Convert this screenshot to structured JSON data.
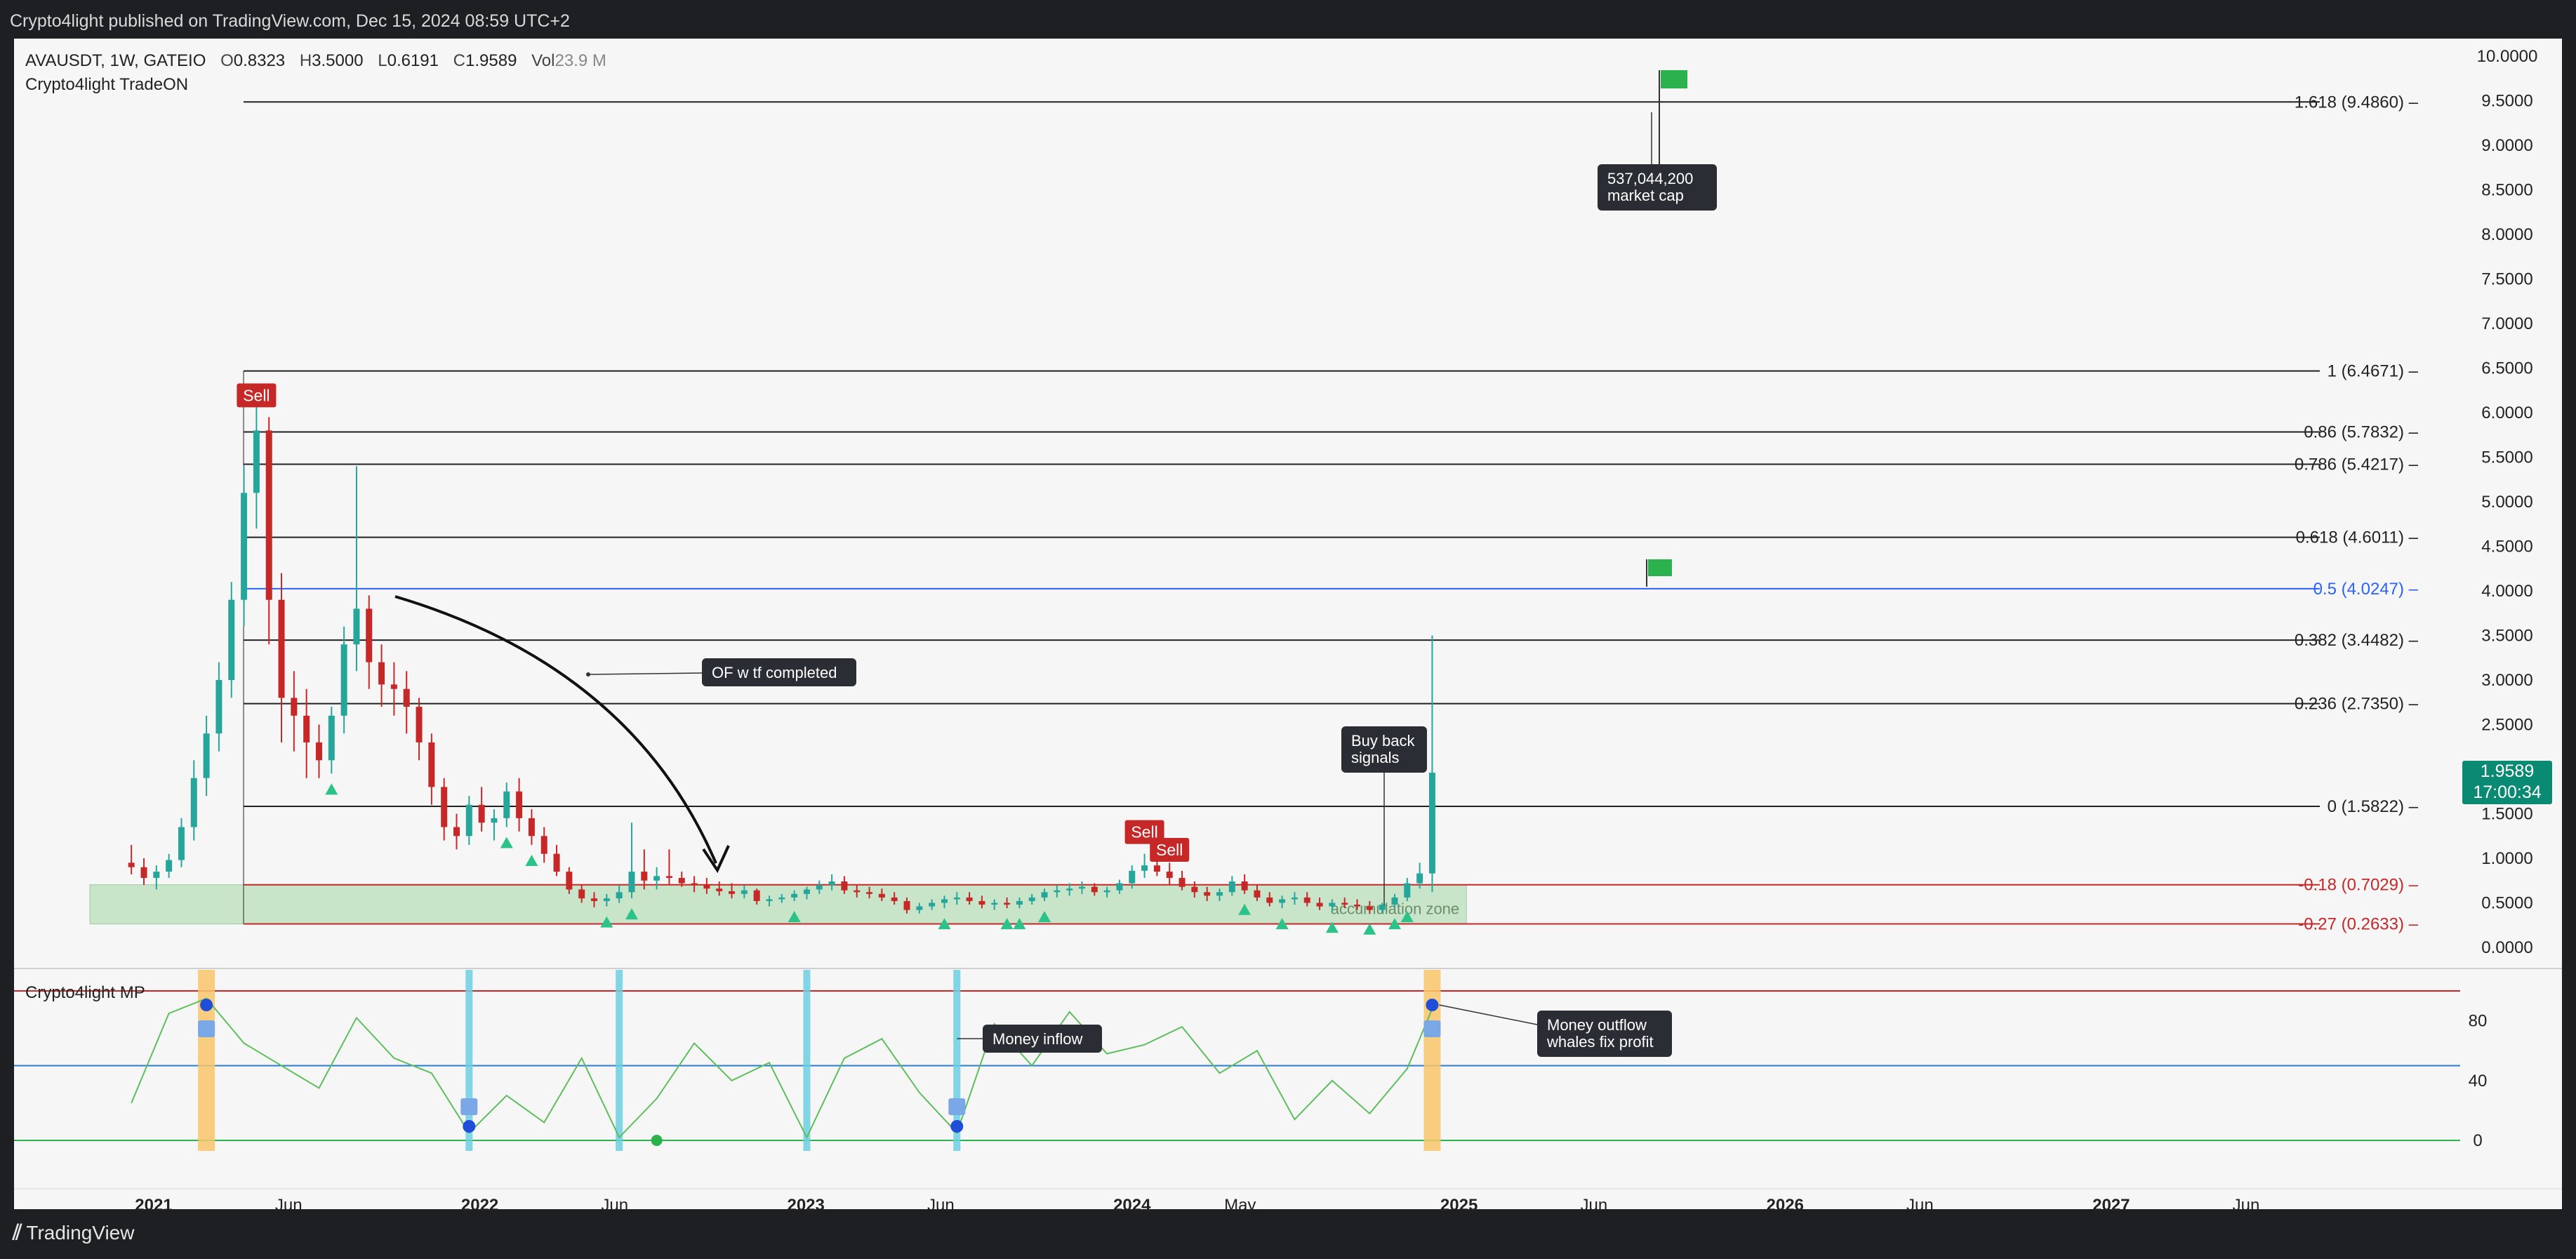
{
  "header": {
    "published": "Crypto4light published on TradingView.com, Dec 15, 2024 08:59 UTC+2"
  },
  "legend": {
    "symbol": "AVAUSDT, 1W, GATEIO",
    "open_label": "O",
    "open": "0.8323",
    "high_label": "H",
    "high": "3.5000",
    "low_label": "L",
    "low": "0.6191",
    "close_label": "C",
    "close": "1.9589",
    "vol_label": "Vol",
    "vol": "23.9 M",
    "indicator": "Crypto4light TradeON"
  },
  "current_price": {
    "value": "1.9589",
    "countdown": "17:00:34"
  },
  "oscillator": {
    "title": "Crypto4light MP"
  },
  "brand": {
    "name": "TradingView"
  },
  "colors": {
    "up": "#26a69a",
    "down": "#c62828",
    "fib": "#222222",
    "fib_mid": "#2962ff",
    "fib_neg": "#c62828",
    "zone": "#b9dfba",
    "signal": "#2cc38b",
    "osc_line": "#5cbf5c",
    "inflow": "#6ccfe0",
    "outflow": "#f9c56b"
  },
  "chart_data": [
    {
      "type": "candlestick",
      "title": "AVAUSDT, 1W, GATEIO",
      "ylim": [
        0,
        10
      ],
      "y_ticks": [
        "0.0000",
        "0.5000",
        "1.0000",
        "1.5000",
        "2.0000",
        "2.5000",
        "3.0000",
        "3.5000",
        "4.0000",
        "4.5000",
        "5.0000",
        "5.5000",
        "6.0000",
        "6.5000",
        "7.0000",
        "7.5000",
        "8.0000",
        "8.5000",
        "9.0000",
        "9.5000",
        "10.0000"
      ],
      "x_ticks": [
        "2021",
        "Jun",
        "2022",
        "Jun",
        "2023",
        "Jun",
        "2024",
        "May",
        "2025",
        "Jun",
        "2026",
        "Jun",
        "2027",
        "Jun"
      ],
      "x_tick_dates": [
        "2021-01-01",
        "2021-06-01",
        "2022-01-01",
        "2022-06-01",
        "2023-01-01",
        "2023-06-01",
        "2024-01-01",
        "2024-05-01",
        "2025-01-01",
        "2025-06-01",
        "2026-01-01",
        "2026-06-01",
        "2027-01-01",
        "2027-06-01"
      ],
      "fib_levels": [
        {
          "label": "1.618 (9.4860)",
          "value": 9.486
        },
        {
          "label": "1 (6.4671)",
          "value": 6.4671
        },
        {
          "label": "0.86 (5.7832)",
          "value": 5.7832
        },
        {
          "label": "0.786 (5.4217)",
          "value": 5.4217
        },
        {
          "label": "0.618 (4.6011)",
          "value": 4.6011
        },
        {
          "label": "0.5 (4.0247)",
          "value": 4.0247
        },
        {
          "label": "0.382 (3.4482)",
          "value": 3.4482
        },
        {
          "label": "0.236 (2.7350)",
          "value": 2.735
        },
        {
          "label": "0 (1.5822)",
          "value": 1.5822
        },
        {
          "label": "-0.18 (0.7029)",
          "value": 0.7029
        },
        {
          "label": "-0.27 (0.2633)",
          "value": 0.2633
        }
      ],
      "zone": {
        "label": "accumulation zone",
        "low": 0.2633,
        "high": 0.7029,
        "from": "2020-12-01",
        "to": "2024-12-01"
      },
      "annotations": [
        {
          "text": "OF w tf completed"
        },
        {
          "text": "Buy back signals"
        },
        {
          "text": "537,044,200 market cap"
        }
      ],
      "sell_labels": [
        "Sell",
        "Sell",
        "Sell"
      ],
      "candles": [
        [
          "2020-12-07",
          0.95,
          1.15,
          0.82,
          0.9
        ],
        [
          "2020-12-21",
          0.9,
          1.0,
          0.7,
          0.78
        ],
        [
          "2021-01-04",
          0.78,
          0.92,
          0.65,
          0.85
        ],
        [
          "2021-01-18",
          0.85,
          1.05,
          0.78,
          0.98
        ],
        [
          "2021-02-01",
          0.98,
          1.45,
          0.9,
          1.35
        ],
        [
          "2021-02-15",
          1.35,
          2.1,
          1.2,
          1.9
        ],
        [
          "2021-03-01",
          1.9,
          2.6,
          1.7,
          2.4
        ],
        [
          "2021-03-15",
          2.4,
          3.2,
          2.2,
          3.0
        ],
        [
          "2021-03-29",
          3.0,
          4.1,
          2.8,
          3.9
        ],
        [
          "2021-04-12",
          3.9,
          5.4,
          3.6,
          5.1
        ],
        [
          "2021-04-26",
          5.1,
          6.3,
          4.7,
          5.8
        ],
        [
          "2021-05-10",
          5.8,
          5.95,
          3.4,
          3.9
        ],
        [
          "2021-05-24",
          3.9,
          4.2,
          2.3,
          2.8
        ],
        [
          "2021-06-07",
          2.8,
          3.1,
          2.2,
          2.6
        ],
        [
          "2021-06-21",
          2.6,
          2.9,
          1.9,
          2.3
        ],
        [
          "2021-07-05",
          2.3,
          2.5,
          1.9,
          2.1
        ],
        [
          "2021-07-19",
          2.1,
          2.7,
          1.95,
          2.6
        ],
        [
          "2021-08-02",
          2.6,
          3.6,
          2.4,
          3.4
        ],
        [
          "2021-08-16",
          3.4,
          5.4,
          3.1,
          3.8
        ],
        [
          "2021-08-30",
          3.8,
          3.95,
          2.9,
          3.2
        ],
        [
          "2021-09-13",
          3.2,
          3.4,
          2.7,
          2.95
        ],
        [
          "2021-09-27",
          2.95,
          3.2,
          2.6,
          2.9
        ],
        [
          "2021-10-11",
          2.9,
          3.1,
          2.4,
          2.7
        ],
        [
          "2021-10-25",
          2.7,
          2.8,
          2.1,
          2.3
        ],
        [
          "2021-11-08",
          2.3,
          2.4,
          1.6,
          1.8
        ],
        [
          "2021-11-22",
          1.8,
          1.9,
          1.2,
          1.35
        ],
        [
          "2021-12-06",
          1.35,
          1.5,
          1.1,
          1.25
        ],
        [
          "2021-12-20",
          1.25,
          1.7,
          1.15,
          1.6
        ],
        [
          "2022-01-03",
          1.6,
          1.8,
          1.3,
          1.4
        ],
        [
          "2022-01-17",
          1.4,
          1.55,
          1.2,
          1.45
        ],
        [
          "2022-01-31",
          1.45,
          1.85,
          1.35,
          1.75
        ],
        [
          "2022-02-14",
          1.75,
          1.9,
          1.3,
          1.45
        ],
        [
          "2022-02-28",
          1.45,
          1.55,
          1.15,
          1.25
        ],
        [
          "2022-03-14",
          1.25,
          1.35,
          0.95,
          1.05
        ],
        [
          "2022-03-28",
          1.05,
          1.15,
          0.8,
          0.85
        ],
        [
          "2022-04-11",
          0.85,
          0.9,
          0.6,
          0.65
        ],
        [
          "2022-04-25",
          0.65,
          0.7,
          0.5,
          0.55
        ],
        [
          "2022-05-09",
          0.55,
          0.62,
          0.45,
          0.52
        ],
        [
          "2022-05-23",
          0.52,
          0.6,
          0.46,
          0.55
        ],
        [
          "2022-06-06",
          0.55,
          0.7,
          0.5,
          0.62
        ],
        [
          "2022-06-20",
          0.62,
          1.4,
          0.55,
          0.85
        ],
        [
          "2022-07-04",
          0.85,
          1.1,
          0.65,
          0.75
        ],
        [
          "2022-07-18",
          0.75,
          0.9,
          0.65,
          0.8
        ],
        [
          "2022-08-01",
          0.8,
          1.1,
          0.7,
          0.78
        ],
        [
          "2022-08-15",
          0.78,
          0.85,
          0.68,
          0.72
        ],
        [
          "2022-08-29",
          0.72,
          0.8,
          0.62,
          0.7
        ],
        [
          "2022-09-12",
          0.7,
          0.78,
          0.6,
          0.66
        ],
        [
          "2022-09-26",
          0.66,
          0.74,
          0.58,
          0.63
        ],
        [
          "2022-10-10",
          0.63,
          0.72,
          0.55,
          0.6
        ],
        [
          "2022-10-24",
          0.6,
          0.7,
          0.55,
          0.64
        ],
        [
          "2022-11-07",
          0.64,
          0.66,
          0.48,
          0.52
        ],
        [
          "2022-11-21",
          0.52,
          0.58,
          0.46,
          0.54
        ],
        [
          "2022-12-05",
          0.54,
          0.6,
          0.5,
          0.56
        ],
        [
          "2022-12-19",
          0.56,
          0.64,
          0.52,
          0.6
        ],
        [
          "2023-01-02",
          0.6,
          0.68,
          0.54,
          0.65
        ],
        [
          "2023-01-16",
          0.65,
          0.75,
          0.6,
          0.7
        ],
        [
          "2023-01-30",
          0.7,
          0.82,
          0.64,
          0.74
        ],
        [
          "2023-02-13",
          0.74,
          0.8,
          0.6,
          0.64
        ],
        [
          "2023-02-27",
          0.64,
          0.7,
          0.56,
          0.62
        ],
        [
          "2023-03-13",
          0.62,
          0.68,
          0.55,
          0.6
        ],
        [
          "2023-03-27",
          0.6,
          0.66,
          0.52,
          0.56
        ],
        [
          "2023-04-10",
          0.56,
          0.62,
          0.48,
          0.52
        ],
        [
          "2023-04-24",
          0.52,
          0.56,
          0.38,
          0.42
        ],
        [
          "2023-05-08",
          0.42,
          0.5,
          0.38,
          0.46
        ],
        [
          "2023-05-22",
          0.46,
          0.54,
          0.42,
          0.5
        ],
        [
          "2023-06-05",
          0.5,
          0.58,
          0.44,
          0.54
        ],
        [
          "2023-06-19",
          0.54,
          0.62,
          0.48,
          0.56
        ],
        [
          "2023-07-03",
          0.56,
          0.62,
          0.48,
          0.52
        ],
        [
          "2023-07-17",
          0.52,
          0.58,
          0.44,
          0.48
        ],
        [
          "2023-07-31",
          0.48,
          0.54,
          0.42,
          0.5
        ],
        [
          "2023-08-14",
          0.5,
          0.56,
          0.44,
          0.48
        ],
        [
          "2023-08-28",
          0.48,
          0.56,
          0.44,
          0.52
        ],
        [
          "2023-09-11",
          0.52,
          0.6,
          0.48,
          0.56
        ],
        [
          "2023-09-25",
          0.56,
          0.66,
          0.52,
          0.62
        ],
        [
          "2023-10-09",
          0.62,
          0.7,
          0.56,
          0.64
        ],
        [
          "2023-10-23",
          0.64,
          0.72,
          0.58,
          0.66
        ],
        [
          "2023-11-06",
          0.66,
          0.74,
          0.6,
          0.68
        ],
        [
          "2023-11-20",
          0.68,
          0.72,
          0.58,
          0.62
        ],
        [
          "2023-12-04",
          0.62,
          0.68,
          0.56,
          0.64
        ],
        [
          "2023-12-18",
          0.64,
          0.76,
          0.6,
          0.72
        ],
        [
          "2024-01-01",
          0.72,
          0.92,
          0.66,
          0.86
        ],
        [
          "2024-01-15",
          0.86,
          1.05,
          0.78,
          0.92
        ],
        [
          "2024-01-29",
          0.92,
          1.1,
          0.8,
          0.85
        ],
        [
          "2024-02-12",
          0.85,
          0.95,
          0.7,
          0.78
        ],
        [
          "2024-02-26",
          0.78,
          0.86,
          0.64,
          0.68
        ],
        [
          "2024-03-11",
          0.68,
          0.74,
          0.56,
          0.62
        ],
        [
          "2024-03-25",
          0.62,
          0.68,
          0.52,
          0.58
        ],
        [
          "2024-04-08",
          0.58,
          0.66,
          0.52,
          0.62
        ],
        [
          "2024-04-22",
          0.62,
          0.8,
          0.58,
          0.74
        ],
        [
          "2024-05-06",
          0.74,
          0.82,
          0.6,
          0.64
        ],
        [
          "2024-05-20",
          0.64,
          0.7,
          0.52,
          0.56
        ],
        [
          "2024-06-03",
          0.56,
          0.62,
          0.46,
          0.5
        ],
        [
          "2024-06-17",
          0.5,
          0.58,
          0.44,
          0.54
        ],
        [
          "2024-07-01",
          0.54,
          0.62,
          0.48,
          0.56
        ],
        [
          "2024-07-15",
          0.56,
          0.62,
          0.46,
          0.5
        ],
        [
          "2024-07-29",
          0.5,
          0.56,
          0.42,
          0.46
        ],
        [
          "2024-08-12",
          0.46,
          0.54,
          0.4,
          0.5
        ],
        [
          "2024-08-26",
          0.5,
          0.56,
          0.44,
          0.48
        ],
        [
          "2024-09-09",
          0.48,
          0.54,
          0.42,
          0.46
        ],
        [
          "2024-09-23",
          0.46,
          0.52,
          0.38,
          0.42
        ],
        [
          "2024-10-07",
          0.42,
          0.5,
          0.38,
          0.48
        ],
        [
          "2024-10-21",
          0.48,
          0.6,
          0.44,
          0.56
        ],
        [
          "2024-11-04",
          0.56,
          0.78,
          0.52,
          0.72
        ],
        [
          "2024-11-18",
          0.72,
          0.95,
          0.66,
          0.83
        ],
        [
          "2024-12-02",
          0.83,
          3.5,
          0.62,
          1.96
        ]
      ]
    },
    {
      "type": "line",
      "title": "Crypto4light MP",
      "ylim": [
        0,
        100
      ],
      "y_ticks": [
        "0",
        "40",
        "80"
      ],
      "annotations": [
        {
          "text": "Money inflow"
        },
        {
          "text": "Money outflow whales fix profit"
        }
      ],
      "x": [
        "2020-12-07",
        "2021-01-18",
        "2021-03-01",
        "2021-04-12",
        "2021-05-24",
        "2021-07-05",
        "2021-08-16",
        "2021-09-27",
        "2021-11-08",
        "2021-12-20",
        "2022-01-31",
        "2022-03-14",
        "2022-04-25",
        "2022-06-06",
        "2022-07-18",
        "2022-08-29",
        "2022-10-10",
        "2022-11-21",
        "2023-01-02",
        "2023-02-13",
        "2023-03-27",
        "2023-05-08",
        "2023-06-19",
        "2023-07-31",
        "2023-09-11",
        "2023-10-23",
        "2023-12-04",
        "2024-01-15",
        "2024-02-26",
        "2024-04-08",
        "2024-05-20",
        "2024-07-01",
        "2024-08-12",
        "2024-09-23",
        "2024-11-04",
        "2024-12-02"
      ],
      "values": [
        25,
        85,
        95,
        65,
        50,
        35,
        82,
        55,
        45,
        5,
        30,
        12,
        55,
        2,
        28,
        65,
        40,
        52,
        2,
        55,
        68,
        32,
        5,
        78,
        50,
        86,
        58,
        64,
        76,
        45,
        60,
        14,
        40,
        18,
        48,
        88
      ]
    }
  ]
}
